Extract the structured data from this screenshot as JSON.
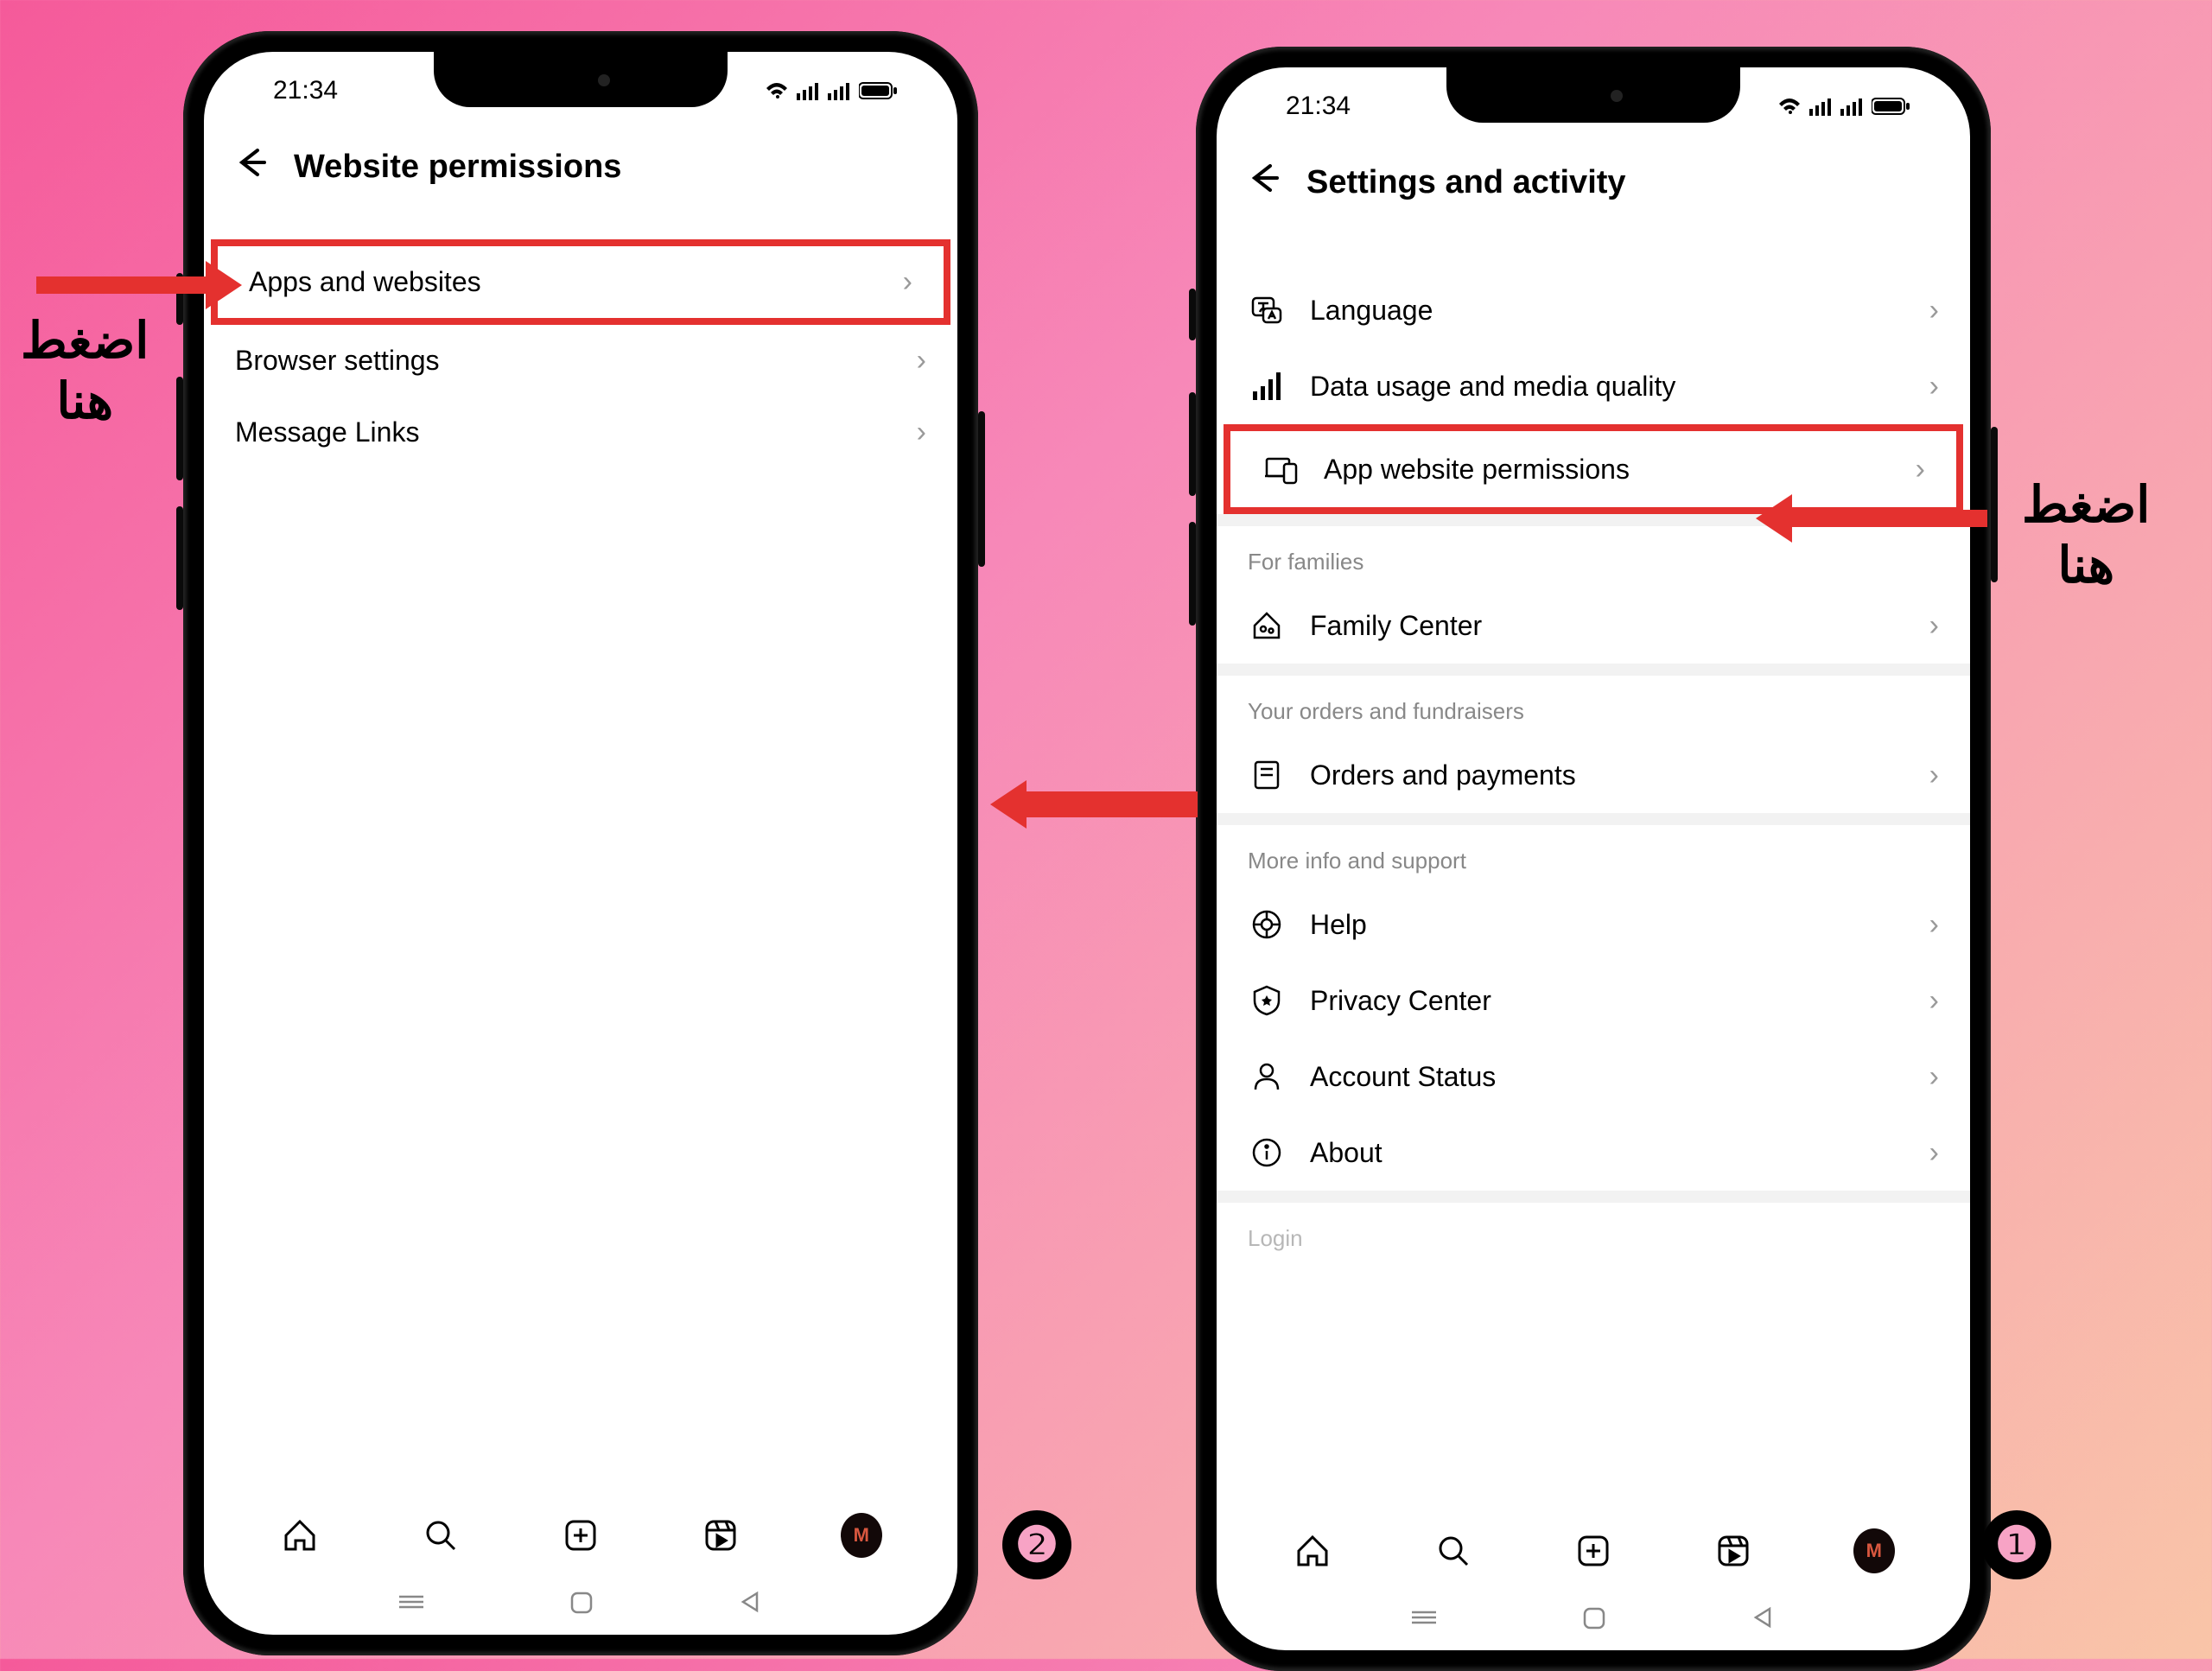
{
  "status": {
    "time": "21:34"
  },
  "phone1": {
    "title": "Settings and activity",
    "rows": {
      "language": "Language",
      "data": "Data usage and media quality",
      "permissions": "App website permissions"
    },
    "sections": {
      "families": "For families",
      "family_center": "Family Center",
      "orders_head": "Your orders and fundraisers",
      "orders": "Orders and payments",
      "support_head": "More info and support",
      "help": "Help",
      "privacy": "Privacy Center",
      "account_status": "Account Status",
      "about": "About",
      "login_head": "Login"
    }
  },
  "phone2": {
    "title": "Website permissions",
    "rows": {
      "apps": "Apps and websites",
      "browser": "Browser settings",
      "msg": "Message Links"
    }
  },
  "annotations": {
    "press_here1": "اضغط",
    "press_here2": "هنا"
  },
  "badges": {
    "one": "❶",
    "two": "❷"
  }
}
